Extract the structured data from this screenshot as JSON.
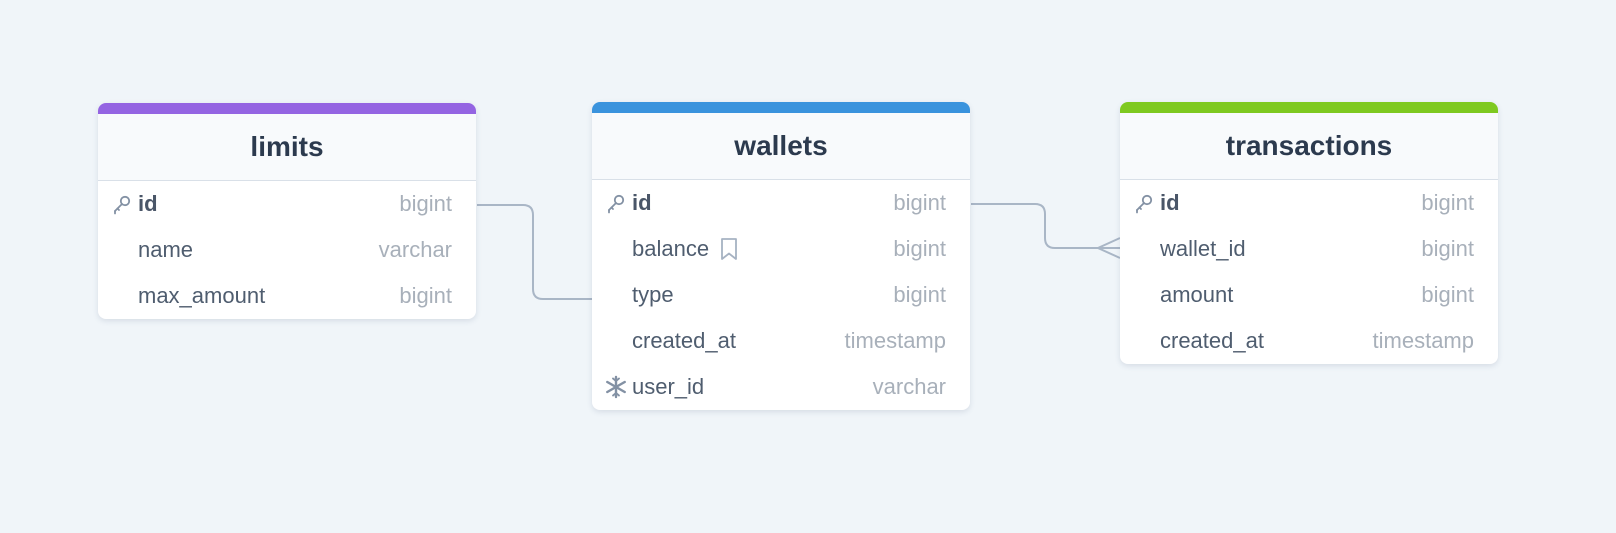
{
  "colors": {
    "background": "#f0f5f9",
    "edge": "#a9b6c6",
    "limits_accent": "#9464e2",
    "wallets_accent": "#3a93dd",
    "transactions_accent": "#7ec920"
  },
  "tables": {
    "limits": {
      "name": "limits",
      "columns": [
        {
          "name": "id",
          "type": "bigint",
          "icon": "key-icon"
        },
        {
          "name": "name",
          "type": "varchar"
        },
        {
          "name": "max_amount",
          "type": "bigint"
        }
      ]
    },
    "wallets": {
      "name": "wallets",
      "columns": [
        {
          "name": "id",
          "type": "bigint",
          "icon": "key-icon"
        },
        {
          "name": "balance",
          "type": "bigint",
          "note_icon": "bookmark-icon"
        },
        {
          "name": "type",
          "type": "bigint"
        },
        {
          "name": "created_at",
          "type": "timestamp"
        },
        {
          "name": "user_id",
          "type": "varchar",
          "icon": "snowflake-icon"
        }
      ]
    },
    "transactions": {
      "name": "transactions",
      "columns": [
        {
          "name": "id",
          "type": "bigint",
          "icon": "key-icon"
        },
        {
          "name": "wallet_id",
          "type": "bigint"
        },
        {
          "name": "amount",
          "type": "bigint"
        },
        {
          "name": "created_at",
          "type": "timestamp"
        }
      ]
    }
  },
  "relations": [
    {
      "from": "limits.id",
      "to": "wallets.type",
      "from_end": "one",
      "to_end": "one"
    },
    {
      "from": "wallets.id",
      "to": "transactions.wallet_id",
      "from_end": "one",
      "to_end": "many"
    }
  ]
}
